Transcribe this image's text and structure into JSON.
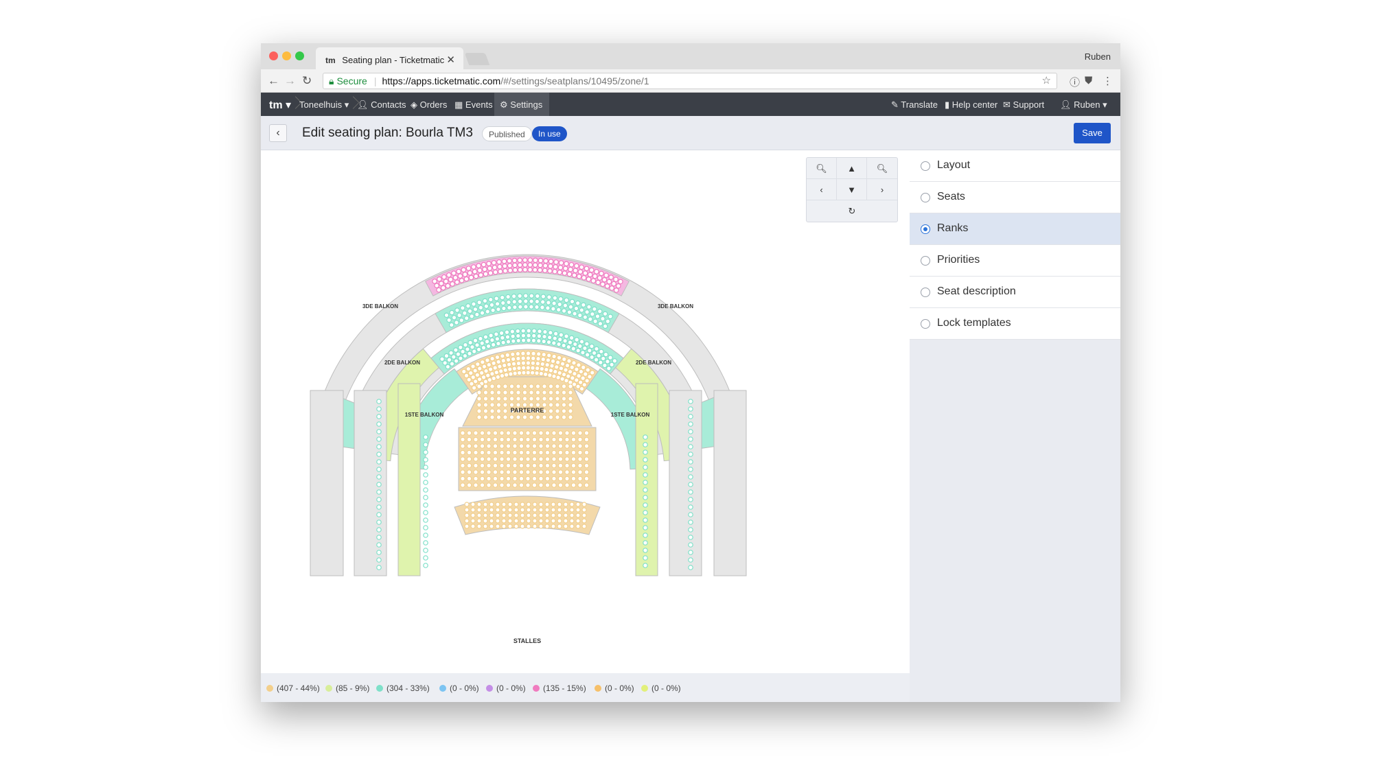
{
  "browser": {
    "tab_title": "Seating plan - Ticketmatic",
    "tab_logo": "tm",
    "profile_name": "Ruben",
    "secure_label": "Secure",
    "url_host": "https://apps.ticketmatic.com",
    "url_path": "/#/settings/seatplans/10495/zone/1"
  },
  "appnav": {
    "logo": "tm",
    "org": "Toneelhuis",
    "items": [
      "Contacts",
      "Orders",
      "Events",
      "Settings"
    ],
    "right_items": [
      "Translate",
      "Help center",
      "Support",
      "Ruben"
    ]
  },
  "header": {
    "title": "Edit seating plan: Bourla TM3",
    "badge_published": "Published",
    "badge_inuse": "In use",
    "save_label": "Save"
  },
  "plan": {
    "labels": {
      "parterre": "PARTERRE",
      "stalles": "STALLES",
      "balkon1": "1STE BALKON",
      "balkon2": "2DE BALKON",
      "balkon3": "3DE BALKON"
    }
  },
  "legend": [
    {
      "text": "(407 - 44%)",
      "color": "#f3cf8b"
    },
    {
      "text": "(85 - 9%)",
      "color": "#d8ee9a"
    },
    {
      "text": "(304 - 33%)",
      "color": "#7fe0c9"
    },
    {
      "text": "(0 - 0%)",
      "color": "#7cc4f2"
    },
    {
      "text": "(0 - 0%)",
      "color": "#c48ee6"
    },
    {
      "text": "(135 - 15%)",
      "color": "#f07bbf"
    },
    {
      "text": "(0 - 0%)",
      "color": "#f6c06a"
    },
    {
      "text": "(0 - 0%)",
      "color": "#e2f07a"
    }
  ],
  "sidepanel": {
    "options": [
      "Layout",
      "Seats",
      "Ranks",
      "Priorities",
      "Seat description",
      "Lock templates"
    ],
    "selected": "Ranks"
  }
}
